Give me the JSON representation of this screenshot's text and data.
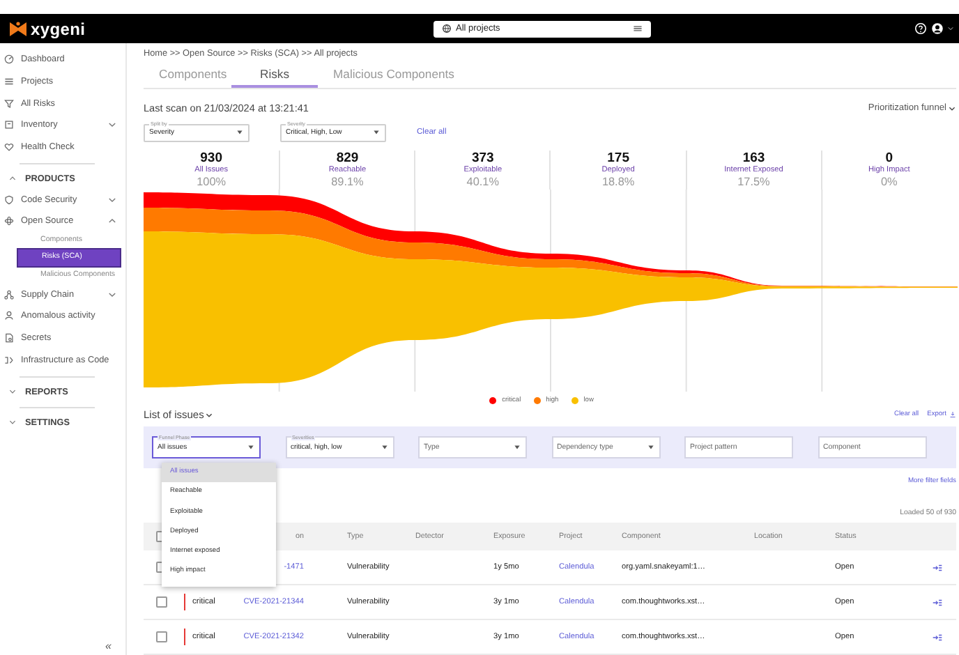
{
  "topbar": {
    "logo": "xygeni",
    "project_selector": "All projects"
  },
  "sidebar": {
    "items": [
      {
        "kind": "link",
        "label": "Dashboard",
        "selected": false
      },
      {
        "kind": "link",
        "label": "Projects",
        "selected": false
      },
      {
        "kind": "link",
        "label": "All Risks",
        "selected": false
      },
      {
        "kind": "group",
        "label": "Inventory",
        "expanded": false,
        "selected": false
      },
      {
        "kind": "link",
        "label": "Health Check",
        "selected": false
      }
    ],
    "sections": [
      {
        "title": "PRODUCTS",
        "expanded": true,
        "items": [
          {
            "kind": "group",
            "label": "Code Security",
            "expanded": false,
            "selected": false
          },
          {
            "kind": "group",
            "label": "Open Source",
            "expanded": true,
            "selected": false,
            "children": [
              {
                "label": "Components",
                "selected": false
              },
              {
                "label": "Risks (SCA)",
                "selected": true
              },
              {
                "label": "Malicious Components",
                "selected": false
              }
            ]
          },
          {
            "kind": "group",
            "label": "Supply Chain",
            "expanded": false,
            "selected": false
          },
          {
            "kind": "link",
            "label": "Anomalous activity",
            "selected": false
          },
          {
            "kind": "link",
            "label": "Secrets",
            "selected": false
          },
          {
            "kind": "link",
            "label": "Infrastructure as Code",
            "selected": false
          }
        ]
      },
      {
        "title": "REPORTS",
        "expanded": false
      },
      {
        "title": "SETTINGS",
        "expanded": false
      }
    ],
    "collapse": "«"
  },
  "breadcrumb": "Home >> Open Source >> Risks (SCA) >> All projects",
  "tabs": [
    {
      "label": "Components",
      "selected": false
    },
    {
      "label": "Risks",
      "selected": true
    },
    {
      "label": "Malicious Components",
      "selected": false
    }
  ],
  "last_scan": "Last scan on 21/03/2024 at 13:21:41",
  "view_selector": "Prioritization funnel",
  "funnel_filters": [
    {
      "label": "Split by",
      "value": "Severity"
    },
    {
      "label": "Severity",
      "value": "Critical, High, Low"
    }
  ],
  "funnel_clear": "Clear all",
  "stages": [
    {
      "count": "930",
      "label": "All Issues",
      "percent": "100%"
    },
    {
      "count": "829",
      "label": "Reachable",
      "percent": "89.1%"
    },
    {
      "count": "373",
      "label": "Exploitable",
      "percent": "40.1%"
    },
    {
      "count": "175",
      "label": "Deployed",
      "percent": "18.8%"
    },
    {
      "count": "163",
      "label": "Internet Exposed",
      "percent": "17.5%"
    },
    {
      "count": "0",
      "label": "High Impact",
      "percent": "0%"
    }
  ],
  "legend": [
    {
      "label": "critical",
      "color": "#ff0000"
    },
    {
      "label": "high",
      "color": "#ff7a00"
    },
    {
      "label": "low",
      "color": "#f9c000"
    }
  ],
  "issues": {
    "title": "List of issues",
    "actions": [
      "Clear all",
      "Export"
    ],
    "filters": [
      {
        "kind": "select",
        "label": "Funnel Phase",
        "value": "All issues",
        "focused": true
      },
      {
        "kind": "select",
        "label": "Severities",
        "value": "critical, high, low",
        "focused": false
      },
      {
        "kind": "select",
        "placeholder": "Type",
        "focused": false
      },
      {
        "kind": "select",
        "placeholder": "Dependency type",
        "focused": false
      },
      {
        "kind": "text",
        "placeholder": "Project pattern",
        "focused": false
      },
      {
        "kind": "text",
        "placeholder": "Component",
        "focused": false
      }
    ],
    "menu": [
      {
        "label": "All issues",
        "selected": true
      },
      {
        "label": "Reachable",
        "selected": false
      },
      {
        "label": "Exploitable",
        "selected": false
      },
      {
        "label": "Deployed",
        "selected": false
      },
      {
        "label": "Internet exposed",
        "selected": false
      },
      {
        "label": "High impact",
        "selected": false
      }
    ],
    "more_filters": "More filter fields",
    "loaded": "Loaded 50 of 930"
  },
  "table": {
    "select_all": false,
    "columns": [
      "on",
      "Type",
      "Detector",
      "Exposure",
      "Project",
      "Component",
      "Location",
      "Status"
    ],
    "rows": [
      {
        "checked": false,
        "id": "-1471",
        "type": "Vulnerability",
        "exposure": "1y 5mo",
        "project": "Calendula",
        "component": "org.yaml.snakeyaml:1…",
        "status": "Open"
      },
      {
        "checked": false,
        "severity": "critical",
        "color": "#e53935",
        "id": "CVE-2021-21344",
        "type": "Vulnerability",
        "exposure": "3y 1mo",
        "project": "Calendula",
        "component": "com.thoughtworks.xst…",
        "status": "Open"
      },
      {
        "checked": false,
        "severity": "critical",
        "color": "#e53935",
        "id": "CVE-2021-21342",
        "type": "Vulnerability",
        "exposure": "3y 1mo",
        "project": "Calendula",
        "component": "com.thoughtworks.xst…",
        "status": "Open"
      }
    ]
  }
}
